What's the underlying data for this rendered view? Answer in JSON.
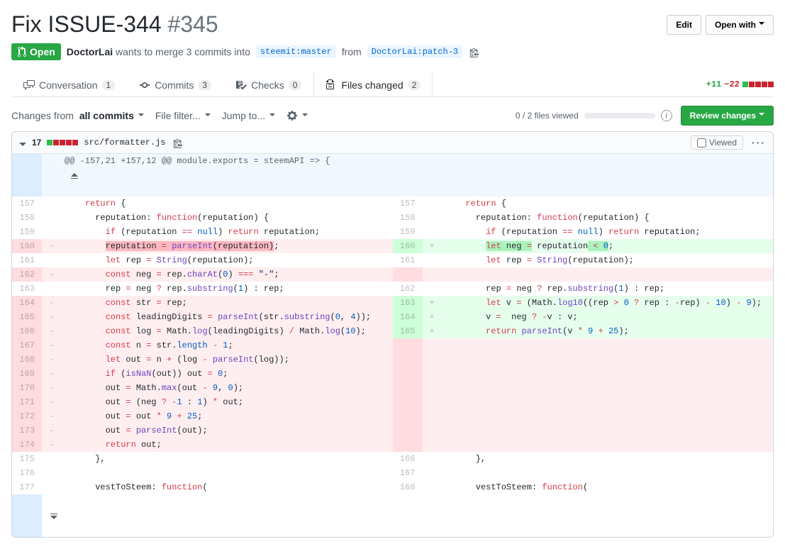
{
  "pr": {
    "title": "Fix ISSUE-344",
    "number": "#345",
    "state": "Open",
    "author": "DoctorLai",
    "wants_text": "wants to merge 3 commits into",
    "base_branch": "steemit:master",
    "from_text": "from",
    "head_branch": "DoctorLai:patch-3"
  },
  "header_buttons": {
    "edit": "Edit",
    "open_with": "Open with"
  },
  "tabs": {
    "conversation": {
      "label": "Conversation",
      "count": "1"
    },
    "commits": {
      "label": "Commits",
      "count": "3"
    },
    "checks": {
      "label": "Checks",
      "count": "0"
    },
    "files": {
      "label": "Files changed",
      "count": "2"
    }
  },
  "diffstat": {
    "add": "+11",
    "del": "−22"
  },
  "toolbar": {
    "changes_from": "Changes from",
    "all_commits": "all commits",
    "file_filter": "File filter...",
    "jump_to": "Jump to...",
    "viewed_progress": "0 / 2 files viewed",
    "review_changes": "Review changes"
  },
  "file": {
    "change_count": "17",
    "path": "src/formatter.js",
    "viewed_label": "Viewed"
  },
  "hunk": "@@ -157,21 +157,12 @@ module.exports = steemAPI => {",
  "left": [
    {
      "n": "157",
      "s": "",
      "cls": "",
      "html": "    <span class='k'>return</span> {"
    },
    {
      "n": "158",
      "s": "",
      "cls": "",
      "html": "      <span class='p'>reputation</span>: <span class='k'>function</span>(<span class='p'>reputation</span>) {"
    },
    {
      "n": "159",
      "s": "",
      "cls": "",
      "html": "        <span class='k'>if</span> (reputation <span class='k'>==</span> <span class='n'>null</span>) <span class='k'>return</span> reputation;"
    },
    {
      "n": "160",
      "s": "-",
      "cls": "del",
      "html": "        <span class='hl-del'>reputation <span class='k'>=</span> <span class='f'>parseInt</span>(reputation)</span>;"
    },
    {
      "n": "161",
      "s": "",
      "cls": "",
      "html": "        <span class='k'>let</span> rep <span class='k'>=</span> <span class='f'>String</span>(reputation);"
    },
    {
      "n": "162",
      "s": "-",
      "cls": "del",
      "html": "        <span class='k'>const</span> neg <span class='k'>=</span> rep.<span class='f'>charAt</span>(<span class='n'>0</span>) <span class='k'>===</span> <span class='s'>\"-\"</span>;"
    },
    {
      "n": "163",
      "s": "",
      "cls": "",
      "html": "        rep <span class='k'>=</span> neg <span class='k'>?</span> rep.<span class='f'>substring</span>(<span class='n'>1</span>) : rep;"
    },
    {
      "n": "164",
      "s": "-",
      "cls": "del",
      "html": "        <span class='k'>const</span> str <span class='k'>=</span> rep;"
    },
    {
      "n": "165",
      "s": "-",
      "cls": "del",
      "html": "        <span class='k'>const</span> leadingDigits <span class='k'>=</span> <span class='f'>parseInt</span>(str.<span class='f'>substring</span>(<span class='n'>0</span>, <span class='n'>4</span>));"
    },
    {
      "n": "166",
      "s": "-",
      "cls": "del",
      "html": "        <span class='k'>const</span> log <span class='k'>=</span> Math.<span class='f'>log</span>(leadingDigits) <span class='k'>/</span> Math.<span class='f'>log</span>(<span class='n'>10</span>);"
    },
    {
      "n": "167",
      "s": "-",
      "cls": "del",
      "html": "        <span class='k'>const</span> n <span class='k'>=</span> str.<span class='n'>length</span> <span class='k'>-</span> <span class='n'>1</span>;"
    },
    {
      "n": "168",
      "s": "-",
      "cls": "del",
      "html": "        <span class='k'>let</span> out <span class='k'>=</span> n <span class='k'>+</span> (log <span class='k'>-</span> <span class='f'>parseInt</span>(log));"
    },
    {
      "n": "169",
      "s": "-",
      "cls": "del",
      "html": "        <span class='k'>if</span> (<span class='f'>isNaN</span>(out)) out <span class='k'>=</span> <span class='n'>0</span>;"
    },
    {
      "n": "170",
      "s": "-",
      "cls": "del",
      "html": "        out <span class='k'>=</span> Math.<span class='f'>max</span>(out <span class='k'>-</span> <span class='n'>9</span>, <span class='n'>0</span>);"
    },
    {
      "n": "171",
      "s": "-",
      "cls": "del",
      "html": "        out <span class='k'>=</span> (neg <span class='k'>?</span> <span class='k'>-</span><span class='n'>1</span> : <span class='n'>1</span>) <span class='k'>*</span> out;"
    },
    {
      "n": "172",
      "s": "-",
      "cls": "del",
      "html": "        out <span class='k'>=</span> out <span class='k'>*</span> <span class='n'>9</span> <span class='k'>+</span> <span class='n'>25</span>;"
    },
    {
      "n": "173",
      "s": "-",
      "cls": "del",
      "html": "        out <span class='k'>=</span> <span class='f'>parseInt</span>(out);"
    },
    {
      "n": "174",
      "s": "-",
      "cls": "del",
      "html": "        <span class='k'>return</span> out;"
    },
    {
      "n": "175",
      "s": "",
      "cls": "",
      "html": "      },"
    },
    {
      "n": "176",
      "s": "",
      "cls": "",
      "html": ""
    },
    {
      "n": "177",
      "s": "",
      "cls": "",
      "html": "      <span class='p'>vestToSteem</span>: <span class='k'>function</span>("
    }
  ],
  "right": [
    {
      "n": "157",
      "s": "",
      "cls": "",
      "html": "    <span class='k'>return</span> {"
    },
    {
      "n": "158",
      "s": "",
      "cls": "",
      "html": "      <span class='p'>reputation</span>: <span class='k'>function</span>(<span class='p'>reputation</span>) {"
    },
    {
      "n": "159",
      "s": "",
      "cls": "",
      "html": "        <span class='k'>if</span> (reputation <span class='k'>==</span> <span class='n'>null</span>) <span class='k'>return</span> reputation;"
    },
    {
      "n": "160",
      "s": "+",
      "cls": "add",
      "html": "        <span class='hl-add'><span class='k'>let</span> neg <span class='k'>=</span></span> reputation<span class='hl-add'> <span class='k'>&lt;</span> <span class='n'>0</span></span>;"
    },
    {
      "n": "161",
      "s": "",
      "cls": "",
      "html": "        <span class='k'>let</span> rep <span class='k'>=</span> <span class='f'>String</span>(reputation);"
    },
    {
      "n": "",
      "s": "",
      "cls": "",
      "html": ""
    },
    {
      "n": "162",
      "s": "",
      "cls": "",
      "html": "        rep <span class='k'>=</span> neg <span class='k'>?</span> rep.<span class='f'>substring</span>(<span class='n'>1</span>) : rep;"
    },
    {
      "n": "163",
      "s": "+",
      "cls": "add",
      "html": "        <span class='k'>let</span> v <span class='k'>=</span> (Math.<span class='f'>log10</span>((rep <span class='k'>&gt;</span> <span class='n'>0</span> <span class='k'>?</span> rep : <span class='k'>-</span>rep) <span class='k'>-</span> <span class='n'>10</span>) <span class='k'>-</span> <span class='n'>9</span>);"
    },
    {
      "n": "164",
      "s": "+",
      "cls": "add",
      "html": "        v <span class='k'>=</span>  neg <span class='k'>?</span> <span class='k'>-</span>v : v;"
    },
    {
      "n": "165",
      "s": "+",
      "cls": "add",
      "html": "        <span class='k'>return</span> <span class='f'>parseInt</span>(v <span class='k'>*</span> <span class='n'>9</span> <span class='k'>+</span> <span class='n'>25</span>);"
    },
    {
      "n": "",
      "s": "",
      "cls": "",
      "html": ""
    },
    {
      "n": "",
      "s": "",
      "cls": "",
      "html": ""
    },
    {
      "n": "",
      "s": "",
      "cls": "",
      "html": ""
    },
    {
      "n": "",
      "s": "",
      "cls": "",
      "html": ""
    },
    {
      "n": "",
      "s": "",
      "cls": "",
      "html": ""
    },
    {
      "n": "",
      "s": "",
      "cls": "",
      "html": ""
    },
    {
      "n": "",
      "s": "",
      "cls": "",
      "html": ""
    },
    {
      "n": "",
      "s": "",
      "cls": "",
      "html": ""
    },
    {
      "n": "166",
      "s": "",
      "cls": "",
      "html": "      },"
    },
    {
      "n": "167",
      "s": "",
      "cls": "",
      "html": ""
    },
    {
      "n": "168",
      "s": "",
      "cls": "",
      "html": "      <span class='p'>vestToSteem</span>: <span class='k'>function</span>("
    }
  ]
}
